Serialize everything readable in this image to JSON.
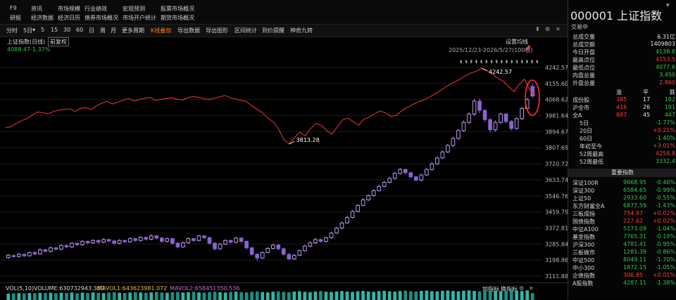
{
  "menu": {
    "row1": [
      "F9",
      "资讯",
      "市场规模",
      "行业绩效",
      "宏观预测",
      "股票市场概况"
    ],
    "row2": [
      "研报",
      "经济数据",
      "经济日历",
      "债券市场概况",
      "市场开户统计",
      "期货市场概况"
    ]
  },
  "toolbar": {
    "items": [
      "分时",
      "5日",
      "5",
      "15",
      "30",
      "60",
      "日",
      "周",
      "月",
      "更多周期",
      "K线叠加",
      "导出数据",
      "导出图形",
      "区间统计",
      "到价提醒",
      "神奇九转"
    ],
    "active": "K线叠加",
    "dropdown_mark": "▾"
  },
  "info": {
    "name": "上证指数(日线)",
    "badge": "前复权",
    "overlay_value": "4088.47",
    "overlay_change": "-1.37%",
    "settings": "设置均线",
    "range": "2025/12/23-2026/5/27(100根)"
  },
  "icons": {
    "arrow_up_icon": "⬆",
    "settings_icon": "⚙",
    "close_icon": "✕",
    "pin_icon": "📌"
  },
  "volume": {
    "label": "VOL(5,10)",
    "volume": "VOLUME:630732943.360",
    "mavol1": "MAVOL1:643623981.072",
    "mavol2": "MAVOL2:658451350.536",
    "add": "加指标",
    "switch": "换指标"
  },
  "side": {
    "code": "000001 上证指数",
    "status": "交易中",
    "stats": [
      {
        "k": "总成交量",
        "v": "6.31亿",
        "c": "white"
      },
      {
        "k": "总成交额",
        "v": "1409803",
        "c": "white"
      },
      {
        "k": "今日开盘",
        "v": "4138.8",
        "c": "green"
      },
      {
        "k": "最高点位",
        "v": "4153.5",
        "c": "red"
      },
      {
        "k": "最低点位",
        "v": "4077.6",
        "c": "green"
      },
      {
        "k": "内盘总量",
        "v": "3.450",
        "c": "green"
      },
      {
        "k": "外盘总量",
        "v": "2.860",
        "c": "red"
      }
    ],
    "breadth_header": [
      "涨",
      "平",
      "跌"
    ],
    "breadth": [
      {
        "k": "成份股",
        "a": "385",
        "b": "17",
        "c": "182"
      },
      {
        "k": "沪全市",
        "a": "416",
        "b": "26",
        "c": "191"
      },
      {
        "k": "全A",
        "a": "887",
        "b": "45",
        "c": "447"
      }
    ],
    "periods": [
      {
        "k": "5日",
        "v": "-1.77%",
        "c": "green"
      },
      {
        "k": "20日",
        "v": "+0.21%",
        "c": "red"
      },
      {
        "k": "60日",
        "v": "-1.40%",
        "c": "green"
      },
      {
        "k": "年初至今",
        "v": "+3.01%",
        "c": "red"
      },
      {
        "k": "52周最高",
        "v": "4258.8",
        "c": "red"
      },
      {
        "k": "52周最低",
        "v": "3332.4",
        "c": "green"
      }
    ],
    "major_title": "重要指数",
    "indices": [
      {
        "k": "深证100R",
        "v": "9668.95",
        "p": "-0.46%",
        "c": "green"
      },
      {
        "k": "深证300",
        "v": "6584.65",
        "p": "-0.99%",
        "c": "green"
      },
      {
        "k": "上证50",
        "v": "2933.60",
        "p": "-0.55%",
        "c": "green"
      },
      {
        "k": "东方财富全A",
        "v": "6877.59",
        "p": "-1.43%",
        "c": "green"
      },
      {
        "k": "三板成指",
        "v": "754.97",
        "p": "+0.02%",
        "c": "red"
      },
      {
        "k": "国债指数",
        "v": "227.62",
        "p": "+0.02%",
        "c": "red"
      },
      {
        "k": "中证A100",
        "v": "5173.09",
        "p": "-1.04%",
        "c": "green"
      },
      {
        "k": "基金指数",
        "v": "7765.31",
        "p": "-0.19%",
        "c": "green"
      },
      {
        "k": "沪深300",
        "v": "4781.41",
        "p": "-0.95%",
        "c": "green"
      },
      {
        "k": "三板做市",
        "v": "1281.39",
        "p": "-0.86%",
        "c": "green"
      },
      {
        "k": "中证500",
        "v": "8049.11",
        "p": "-1.70%",
        "c": "green"
      },
      {
        "k": "中小300",
        "v": "1872.15",
        "p": "-1.05%",
        "c": "green"
      },
      {
        "k": "企债指数",
        "v": "306.85",
        "p": "+0.01%",
        "c": "red"
      },
      {
        "k": "A股指数",
        "v": "4287.11",
        "p": "-1.38%",
        "c": "green"
      }
    ]
  },
  "chart_data": {
    "type": "candlestick",
    "yticks": [
      "4242.57",
      "4155.60",
      "4068.62",
      "3981.64",
      "3894.67",
      "3807.69",
      "3720.72",
      "3633.74",
      "3546.76",
      "3459.79",
      "3372.81",
      "3285.84",
      "3198.86",
      "3111.88"
    ],
    "ylim": [
      3111.88,
      4242.57
    ],
    "annotations": [
      {
        "label": "4242.57"
      },
      {
        "label": "3813.28"
      }
    ],
    "overlay_series_name": "上证指数(日线)",
    "overlay_line": [
      3905,
      3912,
      3930,
      3945,
      3958,
      3978,
      3995,
      3990,
      3985,
      3998,
      4005,
      4010,
      4012,
      3998,
      4015,
      4020,
      4008,
      4030,
      4045,
      4055,
      4040,
      4050,
      4062,
      4070,
      4058,
      4065,
      4072,
      4078,
      4060,
      4066,
      4070,
      4075,
      4068,
      4062,
      4075,
      4082,
      4078,
      4070,
      4065,
      4072,
      4080,
      4088,
      4075,
      4068,
      4060,
      4055,
      4030,
      4010,
      3990,
      3960,
      3940,
      3900,
      3840,
      3813.28,
      3850,
      3880,
      3860,
      3900,
      3930,
      3920,
      3890,
      3870,
      3910,
      3950,
      3960,
      3940,
      3920,
      3955,
      3965,
      3985,
      4000,
      3990,
      3970,
      3975,
      4000,
      4020,
      4035,
      4050,
      4060,
      4075,
      4092,
      4110,
      4130,
      4150,
      4165,
      4180,
      4200,
      4215,
      4225,
      4242.57,
      4230,
      4210,
      4185,
      4170,
      4140,
      4110,
      4150,
      4180,
      4120,
      4088.47
    ],
    "candles": [
      [
        3212,
        3225,
        3205,
        3232
      ],
      [
        3223,
        3218,
        3210,
        3230
      ],
      [
        3218,
        3230,
        3212,
        3238
      ],
      [
        3230,
        3222,
        3215,
        3236
      ],
      [
        3222,
        3240,
        3218,
        3246
      ],
      [
        3240,
        3232,
        3225,
        3248
      ],
      [
        3232,
        3255,
        3228,
        3262
      ],
      [
        3255,
        3246,
        3240,
        3260
      ],
      [
        3246,
        3265,
        3240,
        3272
      ],
      [
        3265,
        3258,
        3250,
        3270
      ],
      [
        3258,
        3278,
        3252,
        3285
      ],
      [
        3278,
        3270,
        3262,
        3284
      ],
      [
        3270,
        3290,
        3264,
        3296
      ],
      [
        3290,
        3282,
        3275,
        3295
      ],
      [
        3282,
        3300,
        3276,
        3308
      ],
      [
        3300,
        3292,
        3284,
        3305
      ],
      [
        3292,
        3305,
        3286,
        3312
      ],
      [
        3305,
        3296,
        3288,
        3310
      ],
      [
        3296,
        3310,
        3290,
        3318
      ],
      [
        3310,
        3302,
        3294,
        3315
      ],
      [
        3302,
        3290,
        3282,
        3308
      ],
      [
        3290,
        3305,
        3284,
        3312
      ],
      [
        3305,
        3298,
        3290,
        3310
      ],
      [
        3298,
        3315,
        3292,
        3322
      ],
      [
        3315,
        3305,
        3297,
        3320
      ],
      [
        3305,
        3322,
        3300,
        3328
      ],
      [
        3322,
        3312,
        3304,
        3326
      ],
      [
        3312,
        3330,
        3306,
        3338
      ],
      [
        3330,
        3318,
        3310,
        3335
      ],
      [
        3318,
        3300,
        3292,
        3324
      ],
      [
        3300,
        3315,
        3294,
        3320
      ],
      [
        3315,
        3290,
        3282,
        3320
      ],
      [
        3290,
        3270,
        3262,
        3296
      ],
      [
        3270,
        3292,
        3265,
        3298
      ],
      [
        3292,
        3315,
        3286,
        3322
      ],
      [
        3315,
        3305,
        3297,
        3320
      ],
      [
        3305,
        3330,
        3300,
        3336
      ],
      [
        3330,
        3320,
        3312,
        3335
      ],
      [
        3320,
        3290,
        3282,
        3326
      ],
      [
        3290,
        3260,
        3250,
        3296
      ],
      [
        3260,
        3285,
        3255,
        3292
      ],
      [
        3285,
        3305,
        3280,
        3312
      ],
      [
        3305,
        3295,
        3288,
        3310
      ],
      [
        3295,
        3318,
        3290,
        3325
      ],
      [
        3318,
        3300,
        3292,
        3322
      ],
      [
        3300,
        3265,
        3255,
        3306
      ],
      [
        3265,
        3230,
        3222,
        3270
      ],
      [
        3230,
        3210,
        3195,
        3236
      ],
      [
        3210,
        3240,
        3205,
        3246
      ],
      [
        3240,
        3262,
        3235,
        3268
      ],
      [
        3262,
        3280,
        3256,
        3286
      ],
      [
        3280,
        3260,
        3252,
        3286
      ],
      [
        3260,
        3230,
        3222,
        3266
      ],
      [
        3230,
        3205,
        3198,
        3236
      ],
      [
        3205,
        3225,
        3200,
        3232
      ],
      [
        3225,
        3250,
        3220,
        3256
      ],
      [
        3250,
        3275,
        3244,
        3282
      ],
      [
        3275,
        3292,
        3268,
        3300
      ],
      [
        3292,
        3310,
        3286,
        3318
      ],
      [
        3310,
        3300,
        3292,
        3316
      ],
      [
        3300,
        3320,
        3294,
        3326
      ],
      [
        3320,
        3345,
        3314,
        3352
      ],
      [
        3345,
        3372,
        3340,
        3380
      ],
      [
        3372,
        3400,
        3366,
        3408
      ],
      [
        3400,
        3430,
        3395,
        3438
      ],
      [
        3430,
        3462,
        3425,
        3470
      ],
      [
        3462,
        3495,
        3456,
        3502
      ],
      [
        3495,
        3525,
        3490,
        3534
      ],
      [
        3525,
        3548,
        3518,
        3556
      ],
      [
        3548,
        3575,
        3542,
        3582
      ],
      [
        3575,
        3598,
        3570,
        3606
      ],
      [
        3598,
        3620,
        3592,
        3628
      ],
      [
        3620,
        3642,
        3614,
        3650
      ],
      [
        3642,
        3668,
        3636,
        3676
      ],
      [
        3668,
        3690,
        3662,
        3698
      ],
      [
        3690,
        3672,
        3664,
        3695
      ],
      [
        3672,
        3650,
        3642,
        3678
      ],
      [
        3650,
        3632,
        3624,
        3656
      ],
      [
        3632,
        3660,
        3626,
        3666
      ],
      [
        3660,
        3690,
        3654,
        3698
      ],
      [
        3690,
        3720,
        3684,
        3728
      ],
      [
        3720,
        3752,
        3714,
        3760
      ],
      [
        3752,
        3785,
        3746,
        3792
      ],
      [
        3785,
        3820,
        3778,
        3828
      ],
      [
        3820,
        3858,
        3812,
        3866
      ],
      [
        3858,
        3900,
        3850,
        3910
      ],
      [
        3900,
        3945,
        3892,
        3955
      ],
      [
        3945,
        3990,
        3936,
        4000
      ],
      [
        3990,
        4060,
        3980,
        4072
      ],
      [
        4060,
        4010,
        3995,
        4075
      ],
      [
        4010,
        3960,
        3948,
        4015
      ],
      [
        3960,
        3905,
        3890,
        3968
      ],
      [
        3905,
        3945,
        3895,
        3955
      ],
      [
        3945,
        3990,
        3936,
        3998
      ],
      [
        3990,
        3950,
        3940,
        3995
      ],
      [
        3950,
        3912,
        3900,
        3958
      ],
      [
        3912,
        3965,
        3905,
        3972
      ],
      [
        3965,
        4020,
        3958,
        4030
      ],
      [
        4020,
        4068,
        4012,
        4078
      ],
      [
        4140,
        4088,
        4077,
        4153
      ]
    ],
    "volume": [
      5.8,
      6.1,
      6.3,
      6.0,
      6.4,
      6.2,
      6.5,
      6.3,
      6.6,
      6.1,
      6.7,
      6.4,
      6.9,
      6.2,
      6.8,
      6.5,
      7.0,
      6.6,
      6.3,
      6.9,
      7.1,
      6.7,
      6.4,
      6.8,
      7.2,
      6.9,
      6.5,
      7.0,
      7.3,
      6.8,
      6.6,
      7.1,
      7.4,
      6.9,
      7.2,
      7.5,
      7.0,
      6.7,
      7.3,
      7.6,
      7.1,
      6.8,
      7.4,
      7.7,
      7.2,
      6.9,
      7.5,
      7.8,
      7.3,
      7.0,
      7.6,
      7.9,
      7.4,
      7.1,
      7.7,
      8.0,
      7.5,
      7.2,
      7.8,
      8.1,
      7.6,
      7.3,
      7.9,
      8.2,
      7.7,
      7.4,
      8.0,
      8.3,
      7.8,
      7.5,
      8.1,
      8.4,
      7.9,
      7.6,
      8.2,
      8.5,
      8.0,
      7.7,
      8.3,
      8.6,
      8.1,
      7.8,
      8.4,
      8.7,
      8.2,
      7.9,
      8.5,
      8.8,
      8.3,
      8.0,
      8.6,
      8.9,
      8.4,
      8.1,
      8.7,
      9.0,
      8.5,
      8.2,
      8.8,
      6.3
    ]
  }
}
